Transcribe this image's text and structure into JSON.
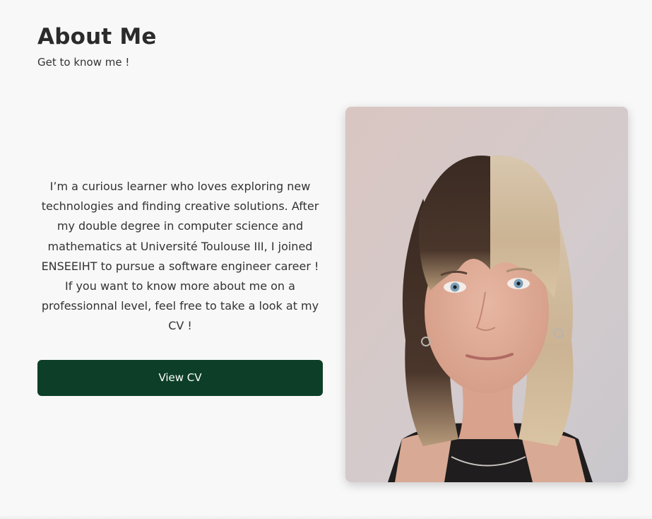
{
  "header": {
    "title": "About Me",
    "subtitle": "Get to know me !"
  },
  "about": {
    "bio": "I’m a curious learner who loves exploring new technologies and finding creative solutions. After my double degree in computer science and mathematics at Université Toulouse III, I joined ENSEEIHT to pursue a software engineer career ! If you want to know more about me on a professionnal level, feel free to take a look at my CV !",
    "cv_button_label": "View CV"
  },
  "colors": {
    "background": "#f8f8f8",
    "button": "#0d3f28",
    "text": "#333333"
  }
}
